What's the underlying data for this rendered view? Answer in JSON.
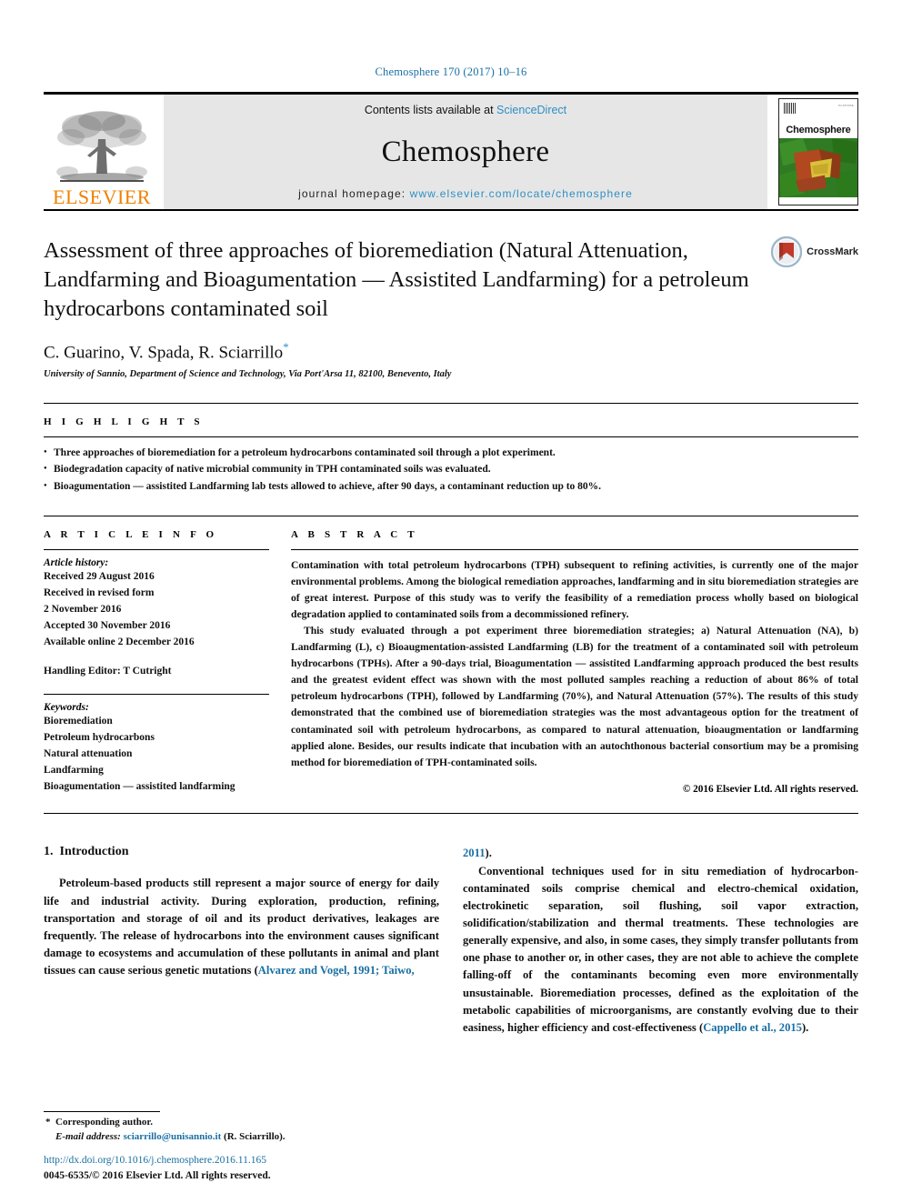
{
  "running_head": "Chemosphere 170 (2017) 10–16",
  "masthead": {
    "publisher_logo_text": "ELSEVIER",
    "contents_prefix": "Contents lists available at ",
    "contents_link": "ScienceDirect",
    "journal_name": "Chemosphere",
    "homepage_prefix": "journal homepage: ",
    "homepage_url": "www.elsevier.com/locate/chemosphere",
    "cover_title": "Chemosphere",
    "cover_tiny_text": "ELSEVIER"
  },
  "article": {
    "title": "Assessment of three approaches of bioremediation (Natural Attenuation, Landfarming and Bioagumentation — Assistited Landfarming) for a petroleum hydrocarbons contaminated soil",
    "authors": "C. Guarino, V. Spada, R. Sciarrillo",
    "corresponding_marker": "*",
    "affiliation": "University of Sannio, Department of Science and Technology, Via Port'Arsa 11, 82100, Benevento, Italy",
    "crossmark_label": "CrossMark"
  },
  "highlights": {
    "heading": "H I G H L I G H T S",
    "items": [
      "Three approaches of bioremediation for a petroleum hydrocarbons contaminated soil through a plot experiment.",
      "Biodegradation capacity of native microbial community in TPH contaminated soils was evaluated.",
      "Bioagumentation — assistited Landfarming lab tests allowed to achieve, after 90 days, a contaminant reduction up to 80%."
    ]
  },
  "article_info": {
    "heading": "A R T I C L E   I N F O",
    "history_label": "Article history:",
    "history_lines": [
      "Received 29 August 2016",
      "Received in revised form",
      "2 November 2016",
      "Accepted 30 November 2016",
      "Available online 2 December 2016"
    ],
    "handling_editor": "Handling Editor: T Cutright",
    "keywords_label": "Keywords:",
    "keywords": [
      "Bioremediation",
      "Petroleum hydrocarbons",
      "Natural attenuation",
      "Landfarming",
      "Bioagumentation — assistited landfarming"
    ]
  },
  "abstract": {
    "heading": "A B S T R A C T",
    "paragraphs": [
      "Contamination with total petroleum hydrocarbons (TPH) subsequent to refining activities, is currently one of the major environmental problems. Among the biological remediation approaches, landfarming and in situ bioremediation strategies are of great interest. Purpose of this study was to verify the feasibility of a remediation process wholly based on biological degradation applied to contaminated soils from a decommissioned refinery.",
      "This study evaluated through a pot experiment three bioremediation strategies; a) Natural Attenuation (NA), b) Landfarming (L), c) Bioaugmentation-assisted Landfarming (LB) for the treatment of a contaminated soil with petroleum hydrocarbons (TPHs). After a 90-days trial, Bioagumentation — assistited Landfarming approach produced the best results and the greatest evident effect was shown with the most polluted samples reaching a reduction of about 86% of total petroleum hydrocarbons (TPH), followed by Landfarming (70%), and Natural Attenuation (57%). The results of this study demonstrated that the combined use of bioremediation strategies was the most advantageous option for the treatment of contaminated soil with petroleum hydrocarbons, as compared to natural attenuation, bioaugmentation or landfarming applied alone. Besides, our results indicate that incubation with an autochthonous bacterial consortium may be a promising method for bioremediation of TPH-contaminated soils."
    ],
    "copyright": "© 2016 Elsevier Ltd. All rights reserved."
  },
  "body": {
    "section_number": "1.",
    "section_title": "Introduction",
    "left_paragraph_part1": "Petroleum-based products still represent a major source of energy for daily life and industrial activity. During exploration, production, refining, transportation and storage of oil and its product derivatives, leakages are frequently. The release of hydrocarbons into the environment causes significant damage to ecosystems and accumulation of these pollutants in animal and plant tissues can cause serious genetic mutations (",
    "left_citation": "Alvarez and Vogel, 1991; Taiwo,",
    "right_citation_continued": "2011",
    "right_citation_close": ").",
    "right_paragraph": "Conventional techniques used for in situ remediation of hydrocarbon-contaminated soils comprise chemical and electro-chemical oxidation, electrokinetic separation, soil flushing, soil vapor extraction, solidification/stabilization and thermal treatments. These technologies are generally expensive, and also, in some cases, they simply transfer pollutants from one phase to another or, in other cases, they are not able to achieve the complete falling-off of the contaminants becoming even more environmentally unsustainable. Bioremediation processes, defined as the exploitation of the metabolic capabilities of microorganisms, are constantly evolving due to their easiness, higher efficiency and cost-effectiveness (",
    "right_citation": "Cappello et al., 2015",
    "right_paragraph_close": ")."
  },
  "footnote": {
    "star": "*",
    "corresponding": "Corresponding author.",
    "email_label": "E-mail address:",
    "email": "sciarrillo@unisannio.it",
    "email_owner": "(R. Sciarrillo)."
  },
  "footer": {
    "doi": "http://dx.doi.org/10.1016/j.chemosphere.2016.11.165",
    "issn_line": "0045-6535/© 2016 Elsevier Ltd. All rights reserved."
  },
  "colors": {
    "link_blue": "#1a6fa3",
    "sciencedirect_blue": "#2f8fc4",
    "elsevier_orange": "#f08000",
    "crossmark_red": "#c0392b",
    "masthead_grey": "#e6e6e6"
  }
}
